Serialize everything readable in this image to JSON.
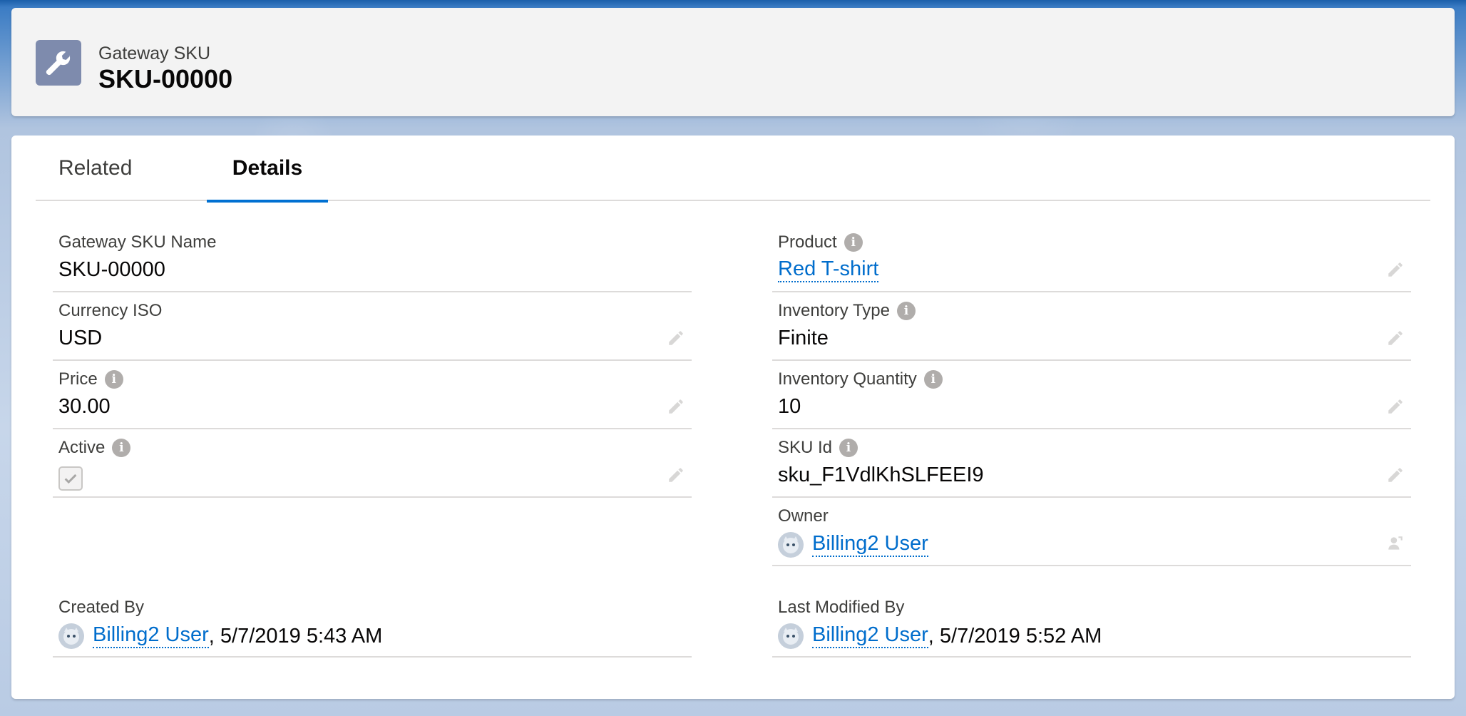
{
  "header": {
    "object_label": "Gateway SKU",
    "record_title": "SKU-00000",
    "icon": "wrench-icon"
  },
  "tabs": [
    {
      "label": "Related",
      "active": false
    },
    {
      "label": "Details",
      "active": true
    }
  ],
  "fields": {
    "gateway_sku_name": {
      "label": "Gateway SKU Name",
      "value": "SKU-00000"
    },
    "currency_iso": {
      "label": "Currency ISO",
      "value": "USD"
    },
    "price": {
      "label": "Price",
      "value": "30.00"
    },
    "active": {
      "label": "Active",
      "checked": true
    },
    "created_by": {
      "label": "Created By",
      "user": "Billing2 User",
      "date": ", 5/7/2019 5:43 AM"
    },
    "product": {
      "label": "Product",
      "value": "Red T-shirt"
    },
    "inventory_type": {
      "label": "Inventory Type",
      "value": "Finite"
    },
    "inventory_quantity": {
      "label": "Inventory Quantity",
      "value": "10"
    },
    "sku_id": {
      "label": "SKU Id",
      "value": "sku_F1VdlKhSLFEEI9"
    },
    "owner": {
      "label": "Owner",
      "user": "Billing2 User"
    },
    "last_modified_by": {
      "label": "Last Modified By",
      "user": "Billing2 User",
      "date": ", 5/7/2019 5:52 AM"
    }
  },
  "colors": {
    "accent": "#0070d2",
    "link": "#006dcc",
    "header_icon_bg": "#7e8bad"
  }
}
